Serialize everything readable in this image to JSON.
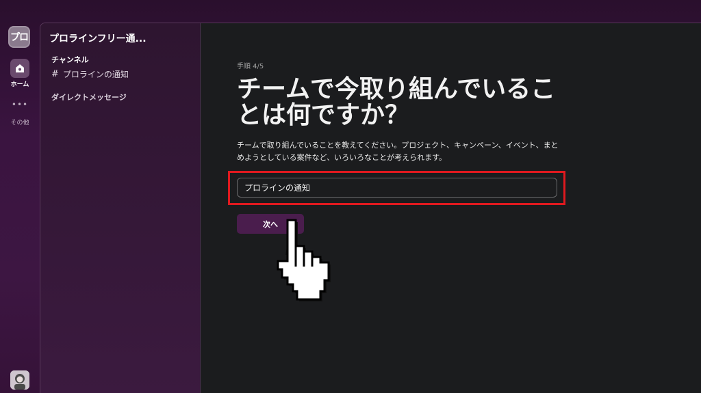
{
  "rail": {
    "workspace_short": "プロ",
    "home_label": "ホーム",
    "more_dots": "•••",
    "more_label": "その他"
  },
  "sidebar": {
    "workspace_name": "プロラインフリー通...",
    "channels_header": "チャンネル",
    "channels": [
      {
        "label": "プロラインの通知",
        "icon": "hash-icon"
      }
    ],
    "dm_header": "ダイレクトメッセージ"
  },
  "main": {
    "step": "手順 4/5",
    "heading": "チームで今取り組んでいることは何ですか？",
    "description": "チームで取り組んでいることを教えてください。プロジェクト、キャンペーン、イベント、まとめようとしている案件など、いろいろなことが考えられます。",
    "input_value": "プロラインの通知",
    "next_label": "次へ"
  },
  "colors": {
    "accent": "#4a1d4d",
    "highlight": "#e0191f",
    "main_bg": "#1b1c1e"
  }
}
